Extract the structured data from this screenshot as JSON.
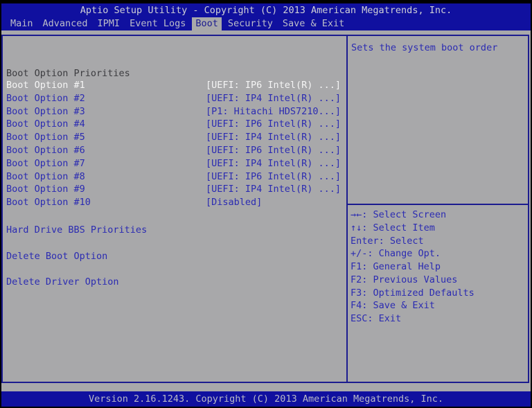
{
  "title_bar": {
    "text": "Aptio Setup Utility - Copyright (C) 2013 American Megatrends, Inc."
  },
  "menu": {
    "items": [
      {
        "label": "Main",
        "selected": false
      },
      {
        "label": "Advanced",
        "selected": false
      },
      {
        "label": "IPMI",
        "selected": false
      },
      {
        "label": "Event Logs",
        "selected": false
      },
      {
        "label": "Boot",
        "selected": true
      },
      {
        "label": "Security",
        "selected": false
      },
      {
        "label": "Save & Exit",
        "selected": false
      }
    ]
  },
  "left_panel": {
    "section_header": "Boot Option Priorities",
    "options": [
      {
        "label": "Boot Option #1",
        "value": "[UEFI: IP6 Intel(R) ...]",
        "selected": true
      },
      {
        "label": "Boot Option #2",
        "value": "[UEFI: IP4 Intel(R) ...]",
        "selected": false
      },
      {
        "label": "Boot Option #3",
        "value": "[P1: Hitachi HDS7210...]",
        "selected": false
      },
      {
        "label": "Boot Option #4",
        "value": "[UEFI: IP6 Intel(R) ...]",
        "selected": false
      },
      {
        "label": "Boot Option #5",
        "value": "[UEFI: IP4 Intel(R) ...]",
        "selected": false
      },
      {
        "label": "Boot Option #6",
        "value": "[UEFI: IP6 Intel(R) ...]",
        "selected": false
      },
      {
        "label": "Boot Option #7",
        "value": "[UEFI: IP4 Intel(R) ...]",
        "selected": false
      },
      {
        "label": "Boot Option #8",
        "value": "[UEFI: IP6 Intel(R) ...]",
        "selected": false
      },
      {
        "label": "Boot Option #9",
        "value": "[UEFI: IP4 Intel(R) ...]",
        "selected": false
      },
      {
        "label": "Boot Option #10",
        "value": "[Disabled]",
        "selected": false
      }
    ],
    "actions": [
      "Hard Drive BBS Priorities",
      "Delete Boot Option",
      "Delete Driver Option"
    ]
  },
  "right_panel": {
    "help_text": "Sets the system boot order",
    "key_hints": [
      "→←: Select Screen",
      "↑↓: Select Item",
      "Enter: Select",
      "+/-: Change Opt.",
      "F1: General Help",
      "F2: Previous Values",
      "F3: Optimized Defaults",
      "F4: Save & Exit",
      "ESC: Exit"
    ]
  },
  "bottom_bar": {
    "text": "Version 2.16.1243. Copyright (C) 2013 American Megatrends, Inc."
  },
  "colors": {
    "bar_blue": "#10109f",
    "body_gray": "#a8a8aa",
    "frame_navy": "#1b1b8f",
    "item_blue": "#2b2bb2",
    "header_dark": "#3c3c40",
    "selected_white": "#f5f5f5"
  }
}
